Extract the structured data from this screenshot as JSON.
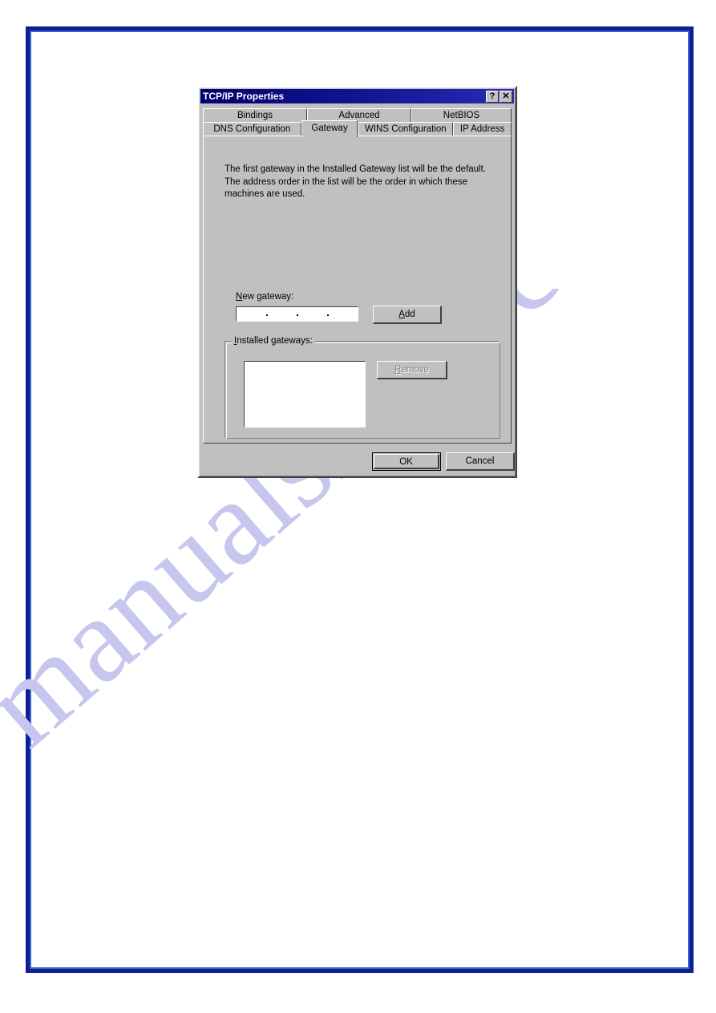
{
  "page": {
    "border_color": "#0b2096",
    "background": "#ffffff"
  },
  "watermark": {
    "text": "manualshive.com",
    "color": "#c6c6ee"
  },
  "dialog": {
    "title": "TCP/IP Properties",
    "titlebar": {
      "help_label": "?",
      "close_label": "✕"
    },
    "tabs_row1": [
      {
        "label": "Bindings",
        "active": false
      },
      {
        "label": "Advanced",
        "active": false
      },
      {
        "label": "NetBIOS",
        "active": false
      }
    ],
    "tabs_row2": [
      {
        "label": "DNS Configuration",
        "active": false
      },
      {
        "label": "Gateway",
        "active": true
      },
      {
        "label": "WINS Configuration",
        "active": false
      },
      {
        "label": "IP Address",
        "active": false
      }
    ],
    "gateway_panel": {
      "info_text": "The first gateway in the Installed Gateway list will be the default. The address order in the list will be the order in which these machines are used.",
      "new_gateway_label": "New gateway:",
      "new_gateway_label_accel": "N",
      "new_gateway_value": "  .   .   .  ",
      "add_label": "Add",
      "add_label_accel": "A",
      "group_title": "Installed gateways:",
      "group_title_accel": "I",
      "installed_gateways": [],
      "remove_label": "Remove",
      "remove_label_accel": "R",
      "remove_disabled": true
    },
    "buttons": {
      "ok_label": "OK",
      "cancel_label": "Cancel"
    }
  }
}
